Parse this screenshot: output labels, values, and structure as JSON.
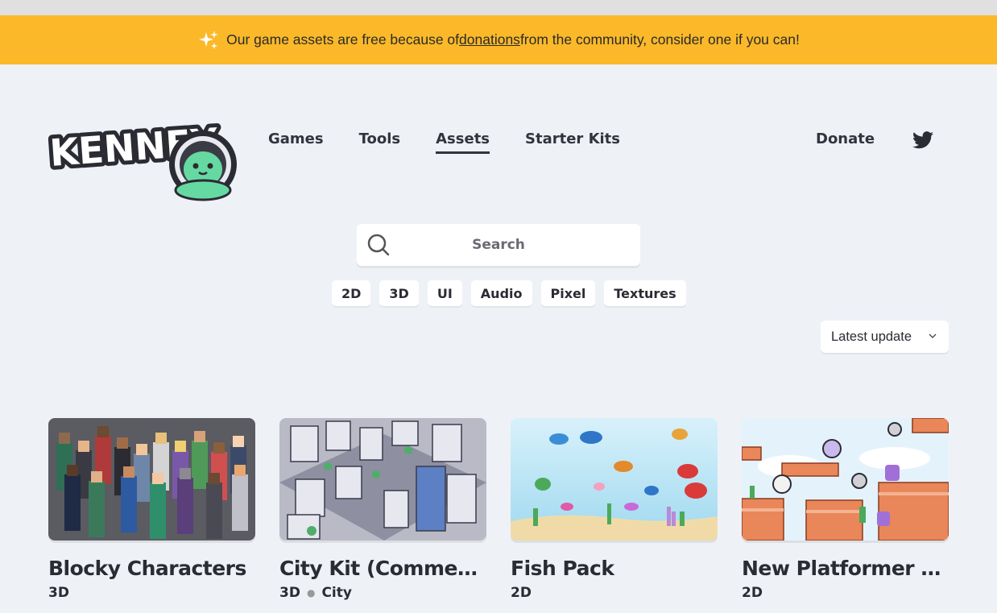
{
  "banner": {
    "text_before": "Our game assets are free because of ",
    "link": "donations",
    "text_after": " from the community, consider one if you can!",
    "icon": "sparkle-icon"
  },
  "logo": {
    "text": "KENNEY",
    "icon": "octopus-mascot"
  },
  "nav": {
    "items": [
      "Games",
      "Tools",
      "Assets",
      "Starter Kits"
    ],
    "active": "Assets",
    "donate": "Donate",
    "social_icon": "twitter-icon"
  },
  "search": {
    "placeholder": "Search",
    "icon": "search-icon"
  },
  "filters": [
    "2D",
    "3D",
    "UI",
    "Audio",
    "Pixel",
    "Textures"
  ],
  "sort": {
    "selected": "Latest update",
    "icon": "chevron-down-icon"
  },
  "colors": {
    "banner": "#fbb929",
    "background": "#eef2f7",
    "text": "#2b2b33"
  },
  "cards": [
    {
      "title": "Blocky Characters",
      "tags": [
        "3D"
      ]
    },
    {
      "title": "City Kit (Commercial)",
      "tags": [
        "3D",
        "City"
      ]
    },
    {
      "title": "Fish Pack",
      "tags": [
        "2D"
      ]
    },
    {
      "title": "New Platformer Pack",
      "tags": [
        "2D"
      ]
    }
  ]
}
